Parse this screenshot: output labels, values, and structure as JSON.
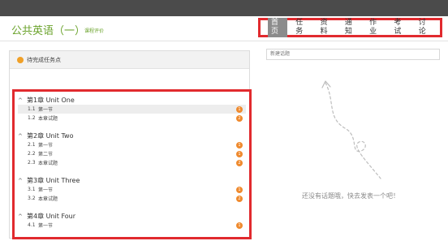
{
  "header": {
    "course_title": "公共英语（一）",
    "course_eval": "课程评价",
    "nav": [
      {
        "label": "首页",
        "active": true
      },
      {
        "label": "任务",
        "active": false
      },
      {
        "label": "资料",
        "active": false
      },
      {
        "label": "通知",
        "active": false
      },
      {
        "label": "作业",
        "active": false
      },
      {
        "label": "考试",
        "active": false
      },
      {
        "label": "讨论",
        "active": false
      }
    ]
  },
  "pending": {
    "label": "待完成任务点"
  },
  "chapters": [
    {
      "title": "第1章 Unit One",
      "sections": [
        {
          "num": "1.1",
          "name": "第一节",
          "badge": "1",
          "badge_color": "#ef8a2e"
        },
        {
          "num": "1.2",
          "name": "本章试题",
          "badge": "2",
          "badge_color": "#ef8a2e"
        }
      ]
    },
    {
      "title": "第2章 Unit Two",
      "sections": [
        {
          "num": "2.1",
          "name": "第一节",
          "badge": "1",
          "badge_color": "#ef8a2e"
        },
        {
          "num": "2.2",
          "name": "第二节",
          "badge": "1",
          "badge_color": "#ef8a2e"
        },
        {
          "num": "2.3",
          "name": "本章试题",
          "badge": "2",
          "badge_color": "#ef8a2e"
        }
      ]
    },
    {
      "title": "第3章 Unit Three",
      "sections": [
        {
          "num": "3.1",
          "name": "第一节",
          "badge": "1",
          "badge_color": "#ef8a2e"
        },
        {
          "num": "3.2",
          "name": "本章试题",
          "badge": "2",
          "badge_color": "#ef8a2e"
        }
      ]
    },
    {
      "title": "第4章 Unit Four",
      "sections": [
        {
          "num": "4.1",
          "name": "第一节",
          "badge": "1",
          "badge_color": "#ef8a2e"
        }
      ]
    }
  ],
  "discussion": {
    "new_topic_placeholder": "新建话题",
    "empty_message": "还没有话题哦，快去发表一个吧！"
  },
  "colors": {
    "accent_green": "#6ba32c",
    "highlight_red": "#e12a2e",
    "badge_orange": "#ef8a2e",
    "topbar": "#4b4b4b"
  },
  "icons": {
    "caret": "chevron-up-icon",
    "pending_dot": "orange-dot-icon"
  }
}
